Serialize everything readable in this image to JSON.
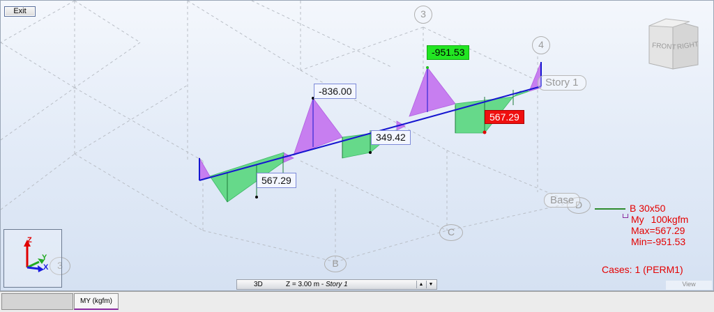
{
  "toolbar": {
    "exit_label": "Exit"
  },
  "grid_labels": [
    "3",
    "4",
    "3",
    "B",
    "C",
    "D"
  ],
  "story_labels": [
    "Story 1",
    "Base"
  ],
  "view_cube": {
    "front": "FRONT",
    "right": "RIGHT"
  },
  "diagram_values": {
    "v_neg_1": "-836.00",
    "v_neg_2": "-951.53",
    "v_pos_1": "567.29",
    "v_pos_2": "349.42",
    "v_max": "567.29"
  },
  "legend": {
    "section": "B 30x50",
    "component": "My",
    "scale": "100kgfm",
    "max": "Max=567.29",
    "min": "Min=-951.53",
    "cases": "Cases: 1 (PERM1)",
    "section_color": "#2e8b2e",
    "text_color": "#e40000"
  },
  "axis_widget": {
    "z": "Z",
    "y": "Y",
    "x": "X"
  },
  "bottom_bar": {
    "mode": "3D",
    "level_prefix": "Z = 3.00 m - ",
    "level_name": "Story 1",
    "view_label": "View"
  },
  "tabs": [
    {
      "label": ""
    },
    {
      "label": "MY (kgfm)",
      "active": true
    }
  ],
  "colors": {
    "beam": "#1515d0",
    "positive_fill": "#66d98a",
    "negative_fill": "#c77ef0",
    "min_badge": "#22e622",
    "max_badge": "#ef0f0f"
  }
}
